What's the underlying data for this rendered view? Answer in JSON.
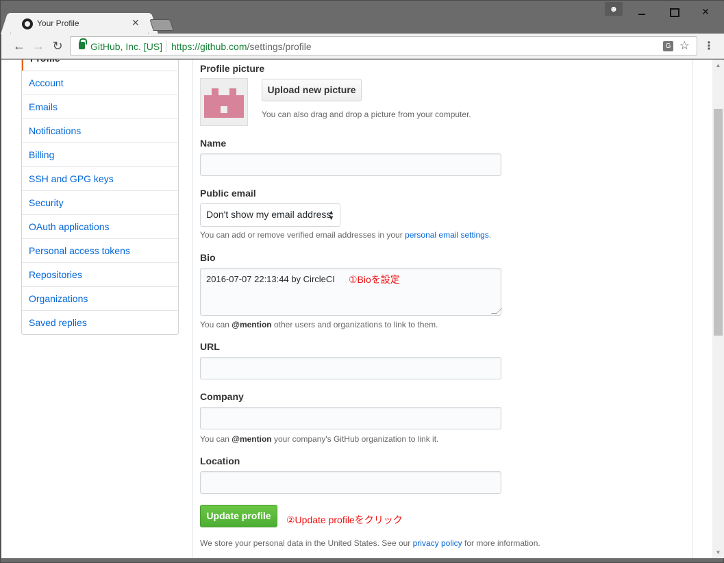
{
  "browser": {
    "tab_title": "Your Profile",
    "tab_close": "✕",
    "site_identity": "GitHub, Inc. [US]",
    "url_scheme_host": "https://github.com",
    "url_path": "/settings/profile",
    "window_close": "✕"
  },
  "sidebar": {
    "items": [
      {
        "label": "Profile"
      },
      {
        "label": "Account"
      },
      {
        "label": "Emails"
      },
      {
        "label": "Notifications"
      },
      {
        "label": "Billing"
      },
      {
        "label": "SSH and GPG keys"
      },
      {
        "label": "Security"
      },
      {
        "label": "OAuth applications"
      },
      {
        "label": "Personal access tokens"
      },
      {
        "label": "Repositories"
      },
      {
        "label": "Organizations"
      },
      {
        "label": "Saved replies"
      }
    ]
  },
  "form": {
    "profile_picture_label": "Profile picture",
    "upload_button": "Upload new picture",
    "upload_note": "You can also drag and drop a picture from your computer.",
    "name_label": "Name",
    "name_value": "",
    "public_email_label": "Public email",
    "public_email_selected": "Don't show my email address",
    "email_note_prefix": "You can add or remove verified email addresses in your ",
    "email_note_link": "personal email settings",
    "email_note_suffix": ".",
    "bio_label": "Bio",
    "bio_value": "2016-07-07 22:13:44 by CircleCI",
    "bio_note_prefix": "You can ",
    "bio_note_mention": "@mention",
    "bio_note_suffix": " other users and organizations to link to them.",
    "url_label": "URL",
    "url_value": "",
    "company_label": "Company",
    "company_value": "",
    "company_note_prefix": "You can ",
    "company_note_mention": "@mention",
    "company_note_suffix": " your company's GitHub organization to link it.",
    "location_label": "Location",
    "location_value": "",
    "update_button": "Update profile",
    "privacy_prefix": "We store your personal data in the United States. See our ",
    "privacy_link": "privacy policy",
    "privacy_suffix": " for more information."
  },
  "annotations": {
    "bio_annotation": "①Bioを設定",
    "update_annotation": "②Update profileをクリック",
    "color": "#e11111"
  },
  "colors": {
    "link": "#0366d6",
    "button_green": "#4cae35",
    "avatar": "#d7849a",
    "secure_green": "#188038"
  }
}
